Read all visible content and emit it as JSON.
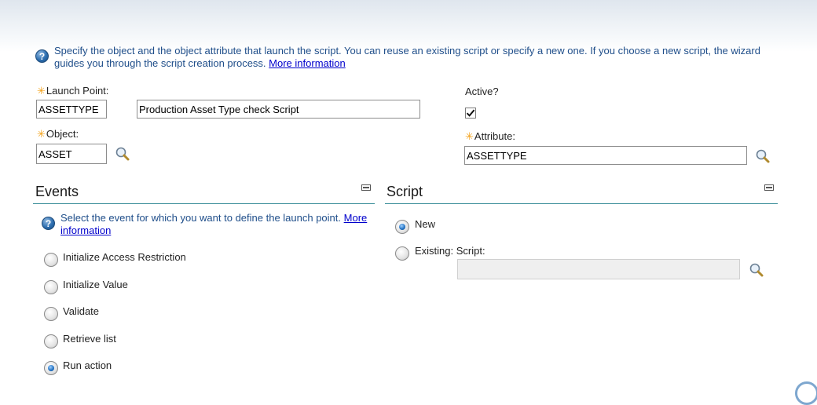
{
  "intro": {
    "text": "Specify the object and the object attribute that launch the script. You can reuse an existing script or specify a new one. If you choose a new script, the wizard guides you through the script creation process.",
    "link": "More information"
  },
  "form": {
    "launch_point_label": "Launch Point:",
    "launch_point_value": "ASSETTYPE",
    "description_value": "Production Asset Type check Script",
    "active_label": "Active?",
    "active_checked": true,
    "object_label": "Object:",
    "object_value": "ASSET",
    "attribute_label": "Attribute:",
    "attribute_value": "ASSETTYPE",
    "required_marker": "✳"
  },
  "events": {
    "title": "Events",
    "help_text": "Select the event for which you want to define the launch point.",
    "help_link": "More information",
    "options": [
      {
        "label": "Initialize Access Restriction",
        "selected": false
      },
      {
        "label": "Initialize Value",
        "selected": false
      },
      {
        "label": "Validate",
        "selected": false
      },
      {
        "label": "Retrieve list",
        "selected": false
      },
      {
        "label": "Run action",
        "selected": true
      }
    ]
  },
  "script": {
    "title": "Script",
    "new_label": "New",
    "new_selected": true,
    "existing_label": "Existing: Script:",
    "existing_selected": false,
    "script_value": ""
  },
  "colors": {
    "help_text": "#1f4e8a",
    "link": "#0000cc",
    "section_rule": "#3b8f9a",
    "required": "#f3a21b"
  },
  "icons": {
    "help": "help-icon",
    "lookup": "magnifier-icon",
    "collapse": "collapse-icon"
  }
}
